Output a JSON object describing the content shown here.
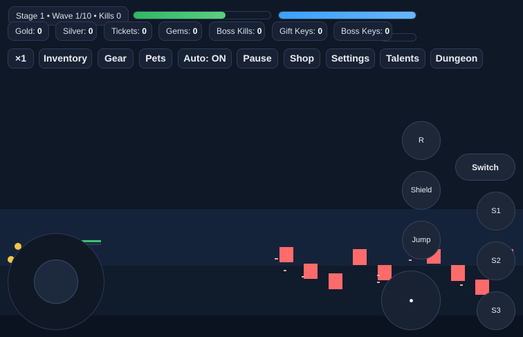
{
  "hud": {
    "stage_text": "Stage 1 • Wave 1/10 • Kills 0",
    "health_fraction": 0.67,
    "mana_fraction": 1.0
  },
  "currencies": [
    {
      "label": "Gold:",
      "value": "0"
    },
    {
      "label": "Silver:",
      "value": "0"
    },
    {
      "label": "Tickets:",
      "value": "0"
    },
    {
      "label": "Gems:",
      "value": "0"
    },
    {
      "label": "Boss Kills:",
      "value": "0"
    },
    {
      "label": "Gift Keys:",
      "value": "0"
    },
    {
      "label": "Boss Keys:",
      "value": "0"
    }
  ],
  "toolbar": {
    "speed": "×1",
    "inventory": "Inventory",
    "gear": "Gear",
    "pets": "Pets",
    "auto": "Auto: ON",
    "pause": "Pause",
    "shop": "Shop",
    "settings": "Settings",
    "talents": "Talents",
    "dungeon": "Dungeon"
  },
  "controls": {
    "r": "R",
    "switch": "Switch",
    "shield": "Shield",
    "jump": "Jump",
    "s1": "S1",
    "s2": "S2",
    "s3": "S3"
  },
  "colors": {
    "health": "#3ec46d",
    "mana": "#4aa8ff",
    "enemy": "#ff6b6b",
    "coin": "#f3c54a"
  }
}
